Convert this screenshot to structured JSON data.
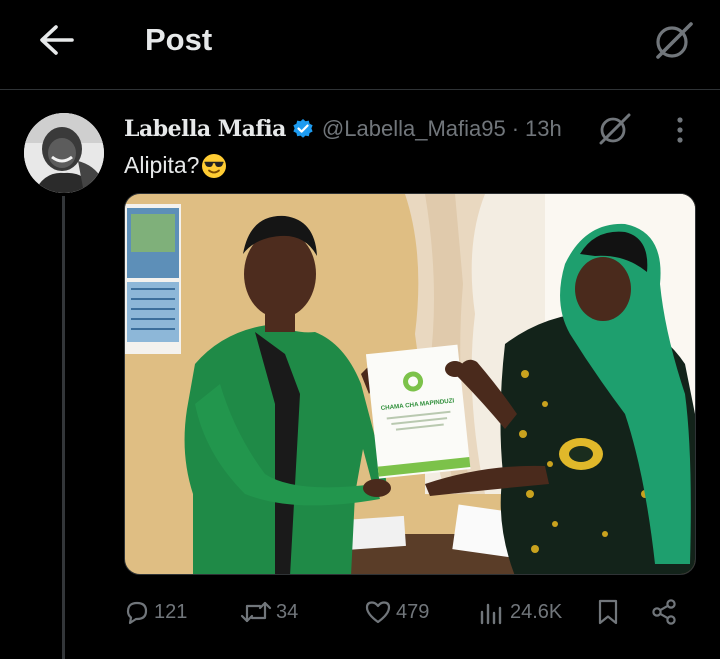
{
  "header": {
    "title": "Post",
    "back_icon": "arrow-left-icon",
    "grok_icon": "grok-icon"
  },
  "post": {
    "display_name": "Labella Mafia",
    "verified": true,
    "handle": "@Labella_Mafia95",
    "separator": "·",
    "timestamp": "13h",
    "text": "Alipita?",
    "emoji": "smiling-face-with-sunglasses",
    "image_certificate_text": "CHAMA CHA MAPINDUZI"
  },
  "actions": {
    "replies": "121",
    "reposts": "34",
    "likes": "479",
    "views": "24.6K"
  },
  "colors": {
    "background": "#000000",
    "text_primary": "#e7e9ea",
    "text_secondary": "#71767b",
    "verified_blue": "#1d9bf0",
    "border": "#2f3336"
  }
}
